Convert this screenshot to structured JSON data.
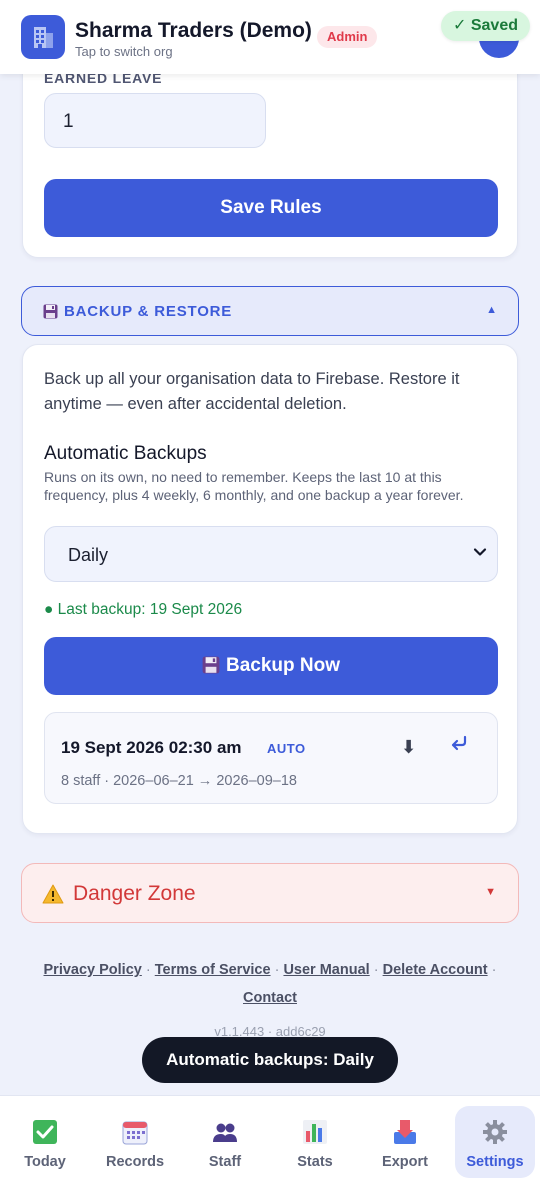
{
  "header": {
    "org_name": "Sharma Traders (Demo)",
    "org_sub": "Tap to switch org",
    "role_badge": "Admin",
    "saved_label": "✓ Saved"
  },
  "rules": {
    "earned_leave_label": "EARNED LEAVE",
    "earned_leave_value": "1",
    "save_label": "Save Rules"
  },
  "backup": {
    "section_title": "BACKUP & RESTORE",
    "intro": "Back up all your organisation data to Firebase. Restore it anytime — even after accidental deletion.",
    "auto_title": "Automatic Backups",
    "auto_desc": "Runs on its own, no need to remember. Keeps the last 10 at this frequency, plus 4 weekly, 6 monthly, and one backup a year forever.",
    "frequency": "Daily",
    "last_backup": "● Last backup: 19 Sept 2026",
    "backup_now_label": "Backup Now",
    "entries": [
      {
        "date": "19 Sept 2026 02:30 am",
        "type": "AUTO",
        "meta": "8 staff · 2026–06–21 → 2026–09–18"
      }
    ]
  },
  "danger": {
    "title": "Danger Zone"
  },
  "footer": {
    "privacy": "Privacy Policy",
    "terms": "Terms of Service",
    "manual": "User Manual",
    "delete_account": "Delete Account",
    "contact": "Contact",
    "sep": "·",
    "version": "v1.1.443 · add6c29"
  },
  "toast": "Automatic backups: Daily",
  "nav": {
    "today": "Today",
    "records": "Records",
    "staff": "Staff",
    "stats": "Stats",
    "export": "Export",
    "settings": "Settings"
  },
  "colors": {
    "primary": "#3d5bd9",
    "danger": "#d23838",
    "success": "#1b8a4a"
  }
}
